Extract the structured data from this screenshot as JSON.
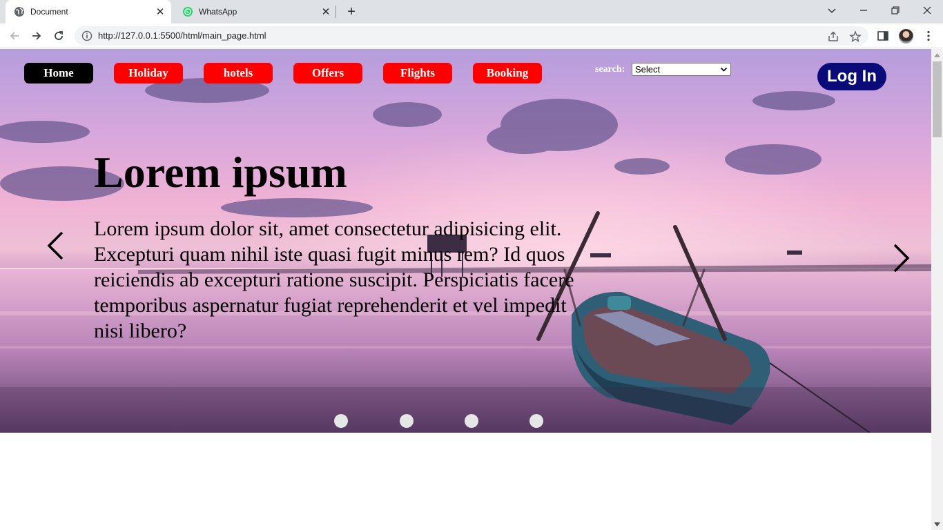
{
  "browser": {
    "tabs": [
      {
        "title": "Document",
        "active": true,
        "favicon": "globe-icon"
      },
      {
        "title": "WhatsApp",
        "active": false,
        "favicon": "whatsapp-icon"
      }
    ],
    "url": "http://127.0.0.1:5500/html/main_page.html"
  },
  "nav": {
    "items": [
      "Home",
      "Holiday",
      "hotels",
      "Offers",
      "Flights",
      "Booking"
    ],
    "active_color": "#000000",
    "item_color": "#ff0000"
  },
  "search": {
    "label": "search:",
    "selected": "Select"
  },
  "login": {
    "label": "Log In",
    "color": "#0a0a78"
  },
  "hero": {
    "title": "Lorem ipsum",
    "text": "Lorem ipsum dolor sit, amet consectetur adipisicing elit. Excepturi quam nihil iste quasi fugit minus rem? Id quos reiciendis ab excepturi ratione suscipit. Perspiciatis facere temporibus aspernatur fugiat reprehenderit et vel impedit nisi libero?",
    "slide_count": 4
  }
}
